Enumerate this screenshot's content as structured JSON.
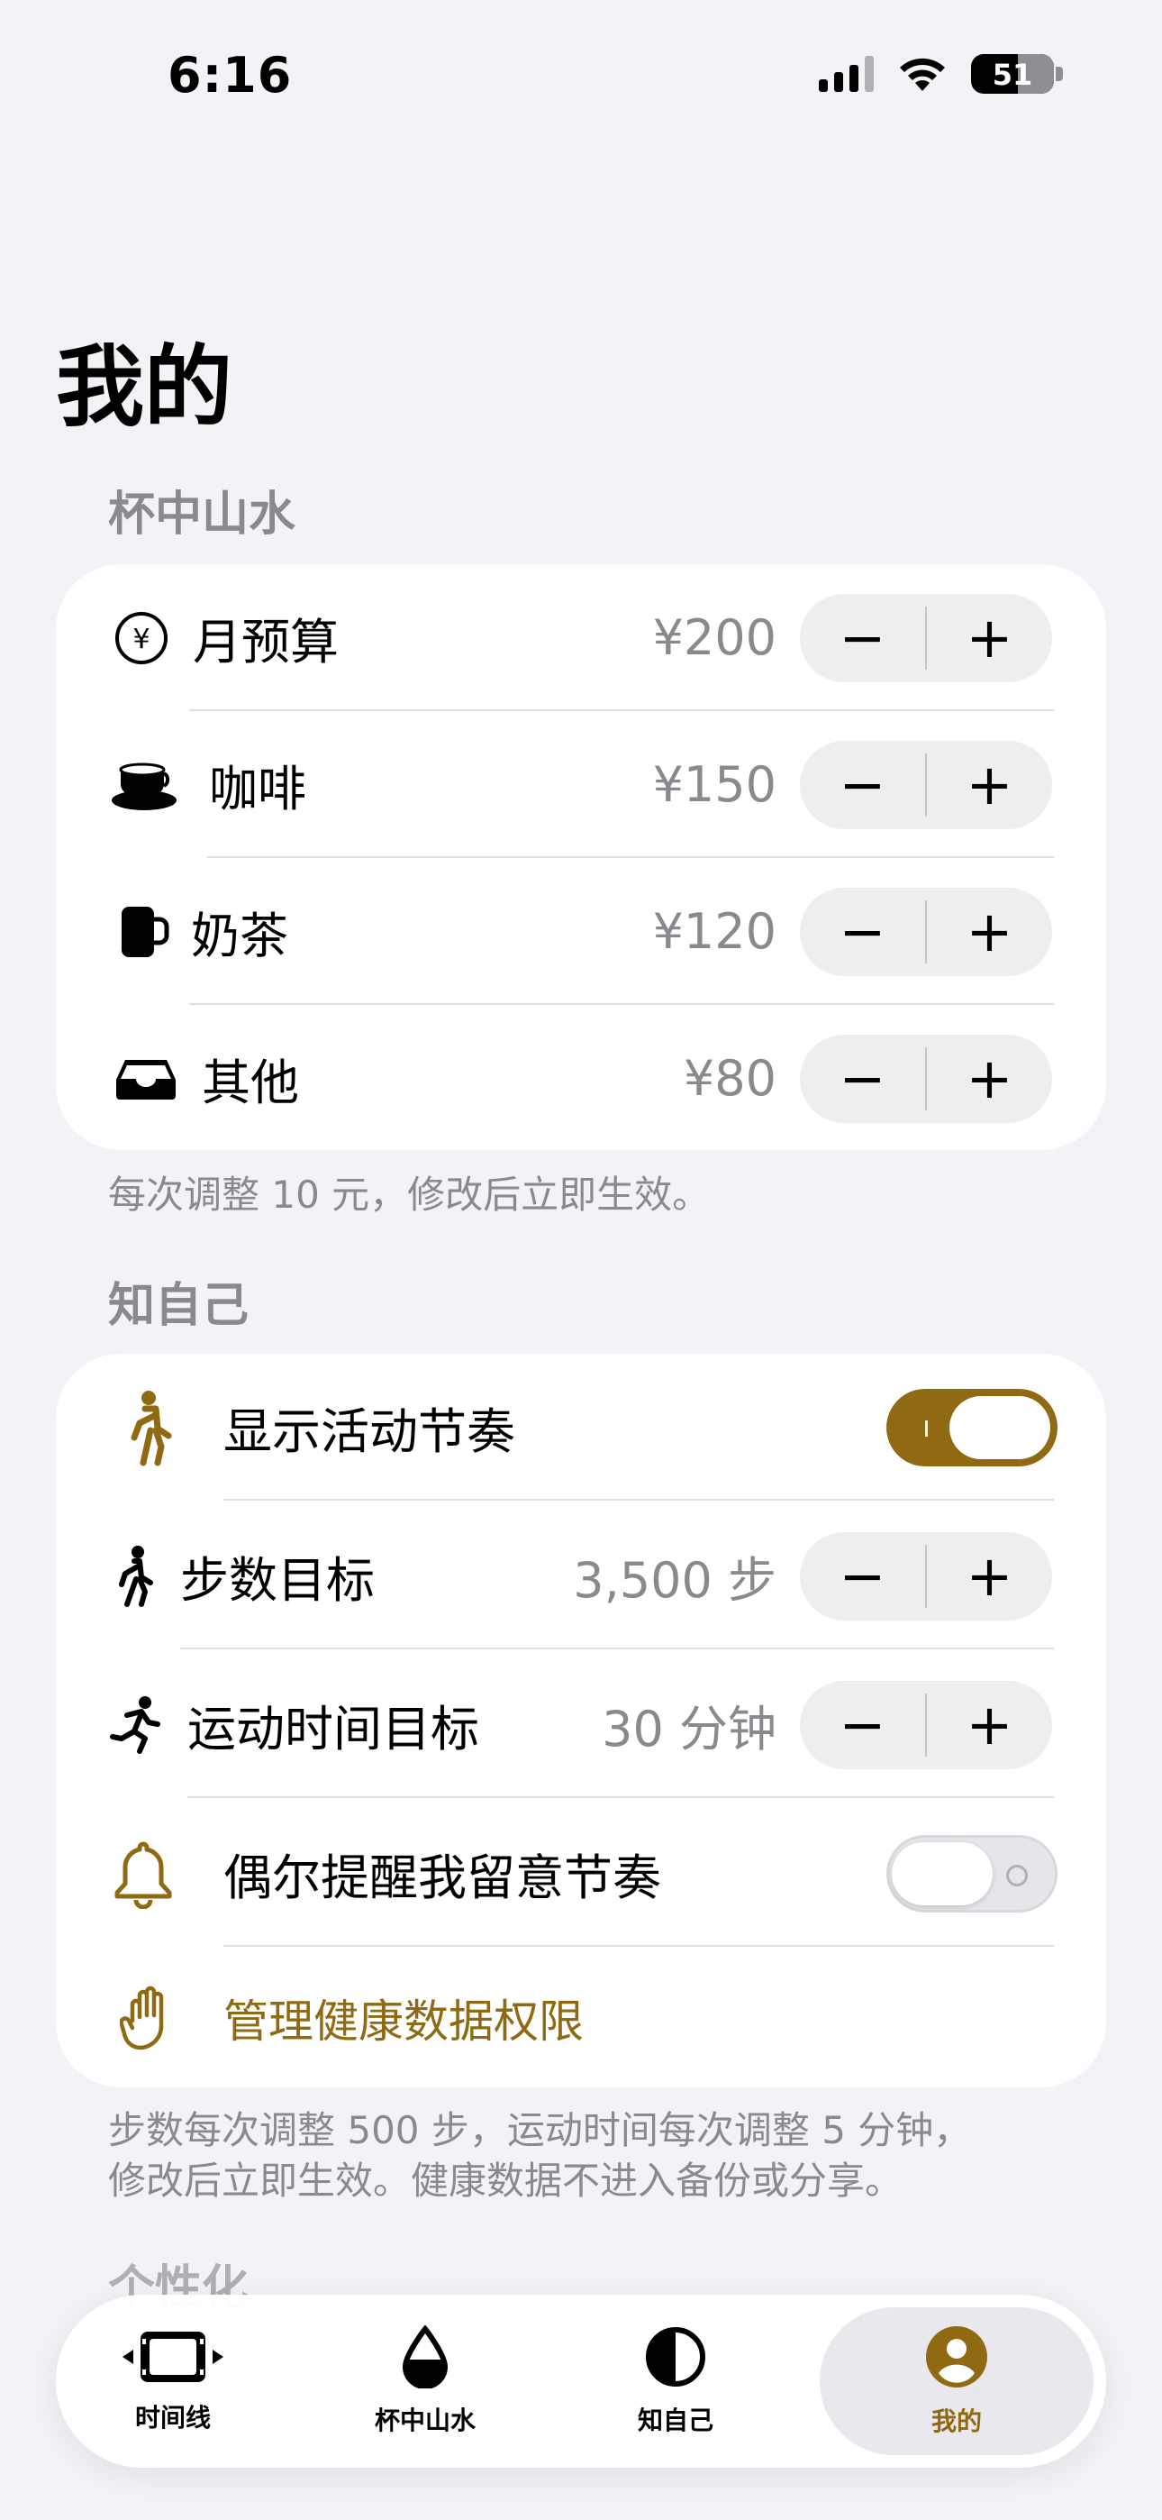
{
  "status_bar": {
    "time": "6:16",
    "battery": "51"
  },
  "page_title": "我的",
  "sections": {
    "cup": {
      "header": "杯中山水",
      "footer": "每次调整 10 元，修改后立即生效。",
      "rows": [
        {
          "label": "月预算",
          "value": "¥200",
          "icon": "yen-circle-icon"
        },
        {
          "label": "咖啡",
          "value": "¥150",
          "icon": "coffee-cup-icon"
        },
        {
          "label": "奶茶",
          "value": "¥120",
          "icon": "mug-icon"
        },
        {
          "label": "其他",
          "value": "¥80",
          "icon": "tray-icon"
        }
      ],
      "stepper": {
        "minus": "−",
        "plus": "+"
      }
    },
    "self": {
      "header": "知自己",
      "footer_line1": "步数每次调整 500 步，运动时间每次调整 5 分钟，",
      "footer_line2": "修改后立即生效。健康数据不进入备份或分享。",
      "show_rhythm": {
        "label": "显示活动节奏",
        "on": true
      },
      "steps_goal": {
        "label": "步数目标",
        "value": "3,500 步"
      },
      "exercise_goal": {
        "label": "运动时间目标",
        "value": "30 分钟"
      },
      "reminder": {
        "label": "偶尔提醒我留意节奏",
        "on": false
      },
      "manage_health": {
        "label": "管理健康数据权限"
      }
    },
    "personalize": {
      "header": "个性化"
    }
  },
  "tab_bar": {
    "tabs": [
      {
        "label": "时间线",
        "icon": "timeline-film-icon"
      },
      {
        "label": "杯中山水",
        "icon": "drop-icon"
      },
      {
        "label": "知自己",
        "icon": "half-circle-icon"
      },
      {
        "label": "我的",
        "icon": "person-circle-icon",
        "active": true
      }
    ]
  },
  "colors": {
    "accent": "#8f6a12",
    "background": "#f2f2f7",
    "secondary_text": "#8a8a8e"
  }
}
